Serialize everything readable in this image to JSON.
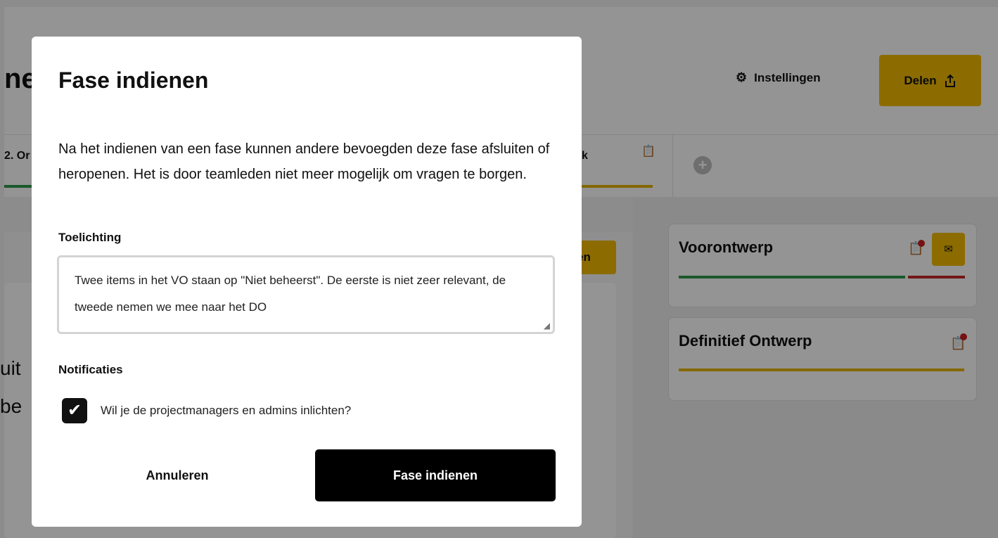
{
  "background": {
    "page_title": "ne",
    "settings_label": "Instellingen",
    "share_label": "Delen",
    "tabs": [
      {
        "label": "2. Or"
      },
      {
        "label": "k"
      }
    ],
    "primary_button_partial": "en",
    "body_text_partial": [
      "uit",
      "be"
    ],
    "phases": [
      {
        "title": "Voorontwerp",
        "bars": [
          "#2e9a4d",
          "#c62828"
        ]
      },
      {
        "title": "Definitief Ontwerp",
        "bars": [
          "#e4b400"
        ]
      }
    ],
    "colors": {
      "accent": "#f1bb00",
      "success": "#2e9a4d",
      "danger": "#cc1f1f"
    }
  },
  "modal": {
    "title": "Fase indienen",
    "description": "Na het indienen van een fase kunnen andere bevoegden deze fase afsluiten of heropenen. Het is door teamleden niet meer mogelijk om vragen te borgen.",
    "explanation_label": "Toelichting",
    "explanation_value": "Twee items in het VO staan op \"Niet beheerst\". De eerste is niet zeer relevant, de tweede nemen we mee naar het DO",
    "notifications_label": "Notificaties",
    "notify_checkbox_checked": true,
    "notify_checkbox_label": "Wil je de projectmanagers en admins inlichten?",
    "cancel_label": "Annuleren",
    "submit_label": "Fase indienen"
  }
}
